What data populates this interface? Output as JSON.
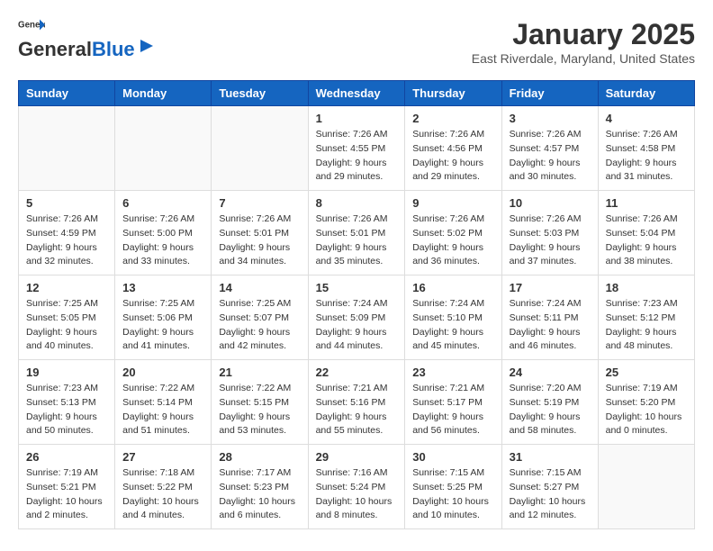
{
  "header": {
    "logo_general": "General",
    "logo_blue": "Blue",
    "month": "January 2025",
    "location": "East Riverdale, Maryland, United States"
  },
  "days_of_week": [
    "Sunday",
    "Monday",
    "Tuesday",
    "Wednesday",
    "Thursday",
    "Friday",
    "Saturday"
  ],
  "weeks": [
    [
      {
        "day": "",
        "info": ""
      },
      {
        "day": "",
        "info": ""
      },
      {
        "day": "",
        "info": ""
      },
      {
        "day": "1",
        "info": "Sunrise: 7:26 AM\nSunset: 4:55 PM\nDaylight: 9 hours\nand 29 minutes."
      },
      {
        "day": "2",
        "info": "Sunrise: 7:26 AM\nSunset: 4:56 PM\nDaylight: 9 hours\nand 29 minutes."
      },
      {
        "day": "3",
        "info": "Sunrise: 7:26 AM\nSunset: 4:57 PM\nDaylight: 9 hours\nand 30 minutes."
      },
      {
        "day": "4",
        "info": "Sunrise: 7:26 AM\nSunset: 4:58 PM\nDaylight: 9 hours\nand 31 minutes."
      }
    ],
    [
      {
        "day": "5",
        "info": "Sunrise: 7:26 AM\nSunset: 4:59 PM\nDaylight: 9 hours\nand 32 minutes."
      },
      {
        "day": "6",
        "info": "Sunrise: 7:26 AM\nSunset: 5:00 PM\nDaylight: 9 hours\nand 33 minutes."
      },
      {
        "day": "7",
        "info": "Sunrise: 7:26 AM\nSunset: 5:01 PM\nDaylight: 9 hours\nand 34 minutes."
      },
      {
        "day": "8",
        "info": "Sunrise: 7:26 AM\nSunset: 5:01 PM\nDaylight: 9 hours\nand 35 minutes."
      },
      {
        "day": "9",
        "info": "Sunrise: 7:26 AM\nSunset: 5:02 PM\nDaylight: 9 hours\nand 36 minutes."
      },
      {
        "day": "10",
        "info": "Sunrise: 7:26 AM\nSunset: 5:03 PM\nDaylight: 9 hours\nand 37 minutes."
      },
      {
        "day": "11",
        "info": "Sunrise: 7:26 AM\nSunset: 5:04 PM\nDaylight: 9 hours\nand 38 minutes."
      }
    ],
    [
      {
        "day": "12",
        "info": "Sunrise: 7:25 AM\nSunset: 5:05 PM\nDaylight: 9 hours\nand 40 minutes."
      },
      {
        "day": "13",
        "info": "Sunrise: 7:25 AM\nSunset: 5:06 PM\nDaylight: 9 hours\nand 41 minutes."
      },
      {
        "day": "14",
        "info": "Sunrise: 7:25 AM\nSunset: 5:07 PM\nDaylight: 9 hours\nand 42 minutes."
      },
      {
        "day": "15",
        "info": "Sunrise: 7:24 AM\nSunset: 5:09 PM\nDaylight: 9 hours\nand 44 minutes."
      },
      {
        "day": "16",
        "info": "Sunrise: 7:24 AM\nSunset: 5:10 PM\nDaylight: 9 hours\nand 45 minutes."
      },
      {
        "day": "17",
        "info": "Sunrise: 7:24 AM\nSunset: 5:11 PM\nDaylight: 9 hours\nand 46 minutes."
      },
      {
        "day": "18",
        "info": "Sunrise: 7:23 AM\nSunset: 5:12 PM\nDaylight: 9 hours\nand 48 minutes."
      }
    ],
    [
      {
        "day": "19",
        "info": "Sunrise: 7:23 AM\nSunset: 5:13 PM\nDaylight: 9 hours\nand 50 minutes."
      },
      {
        "day": "20",
        "info": "Sunrise: 7:22 AM\nSunset: 5:14 PM\nDaylight: 9 hours\nand 51 minutes."
      },
      {
        "day": "21",
        "info": "Sunrise: 7:22 AM\nSunset: 5:15 PM\nDaylight: 9 hours\nand 53 minutes."
      },
      {
        "day": "22",
        "info": "Sunrise: 7:21 AM\nSunset: 5:16 PM\nDaylight: 9 hours\nand 55 minutes."
      },
      {
        "day": "23",
        "info": "Sunrise: 7:21 AM\nSunset: 5:17 PM\nDaylight: 9 hours\nand 56 minutes."
      },
      {
        "day": "24",
        "info": "Sunrise: 7:20 AM\nSunset: 5:19 PM\nDaylight: 9 hours\nand 58 minutes."
      },
      {
        "day": "25",
        "info": "Sunrise: 7:19 AM\nSunset: 5:20 PM\nDaylight: 10 hours\nand 0 minutes."
      }
    ],
    [
      {
        "day": "26",
        "info": "Sunrise: 7:19 AM\nSunset: 5:21 PM\nDaylight: 10 hours\nand 2 minutes."
      },
      {
        "day": "27",
        "info": "Sunrise: 7:18 AM\nSunset: 5:22 PM\nDaylight: 10 hours\nand 4 minutes."
      },
      {
        "day": "28",
        "info": "Sunrise: 7:17 AM\nSunset: 5:23 PM\nDaylight: 10 hours\nand 6 minutes."
      },
      {
        "day": "29",
        "info": "Sunrise: 7:16 AM\nSunset: 5:24 PM\nDaylight: 10 hours\nand 8 minutes."
      },
      {
        "day": "30",
        "info": "Sunrise: 7:15 AM\nSunset: 5:25 PM\nDaylight: 10 hours\nand 10 minutes."
      },
      {
        "day": "31",
        "info": "Sunrise: 7:15 AM\nSunset: 5:27 PM\nDaylight: 10 hours\nand 12 minutes."
      },
      {
        "day": "",
        "info": ""
      }
    ]
  ]
}
